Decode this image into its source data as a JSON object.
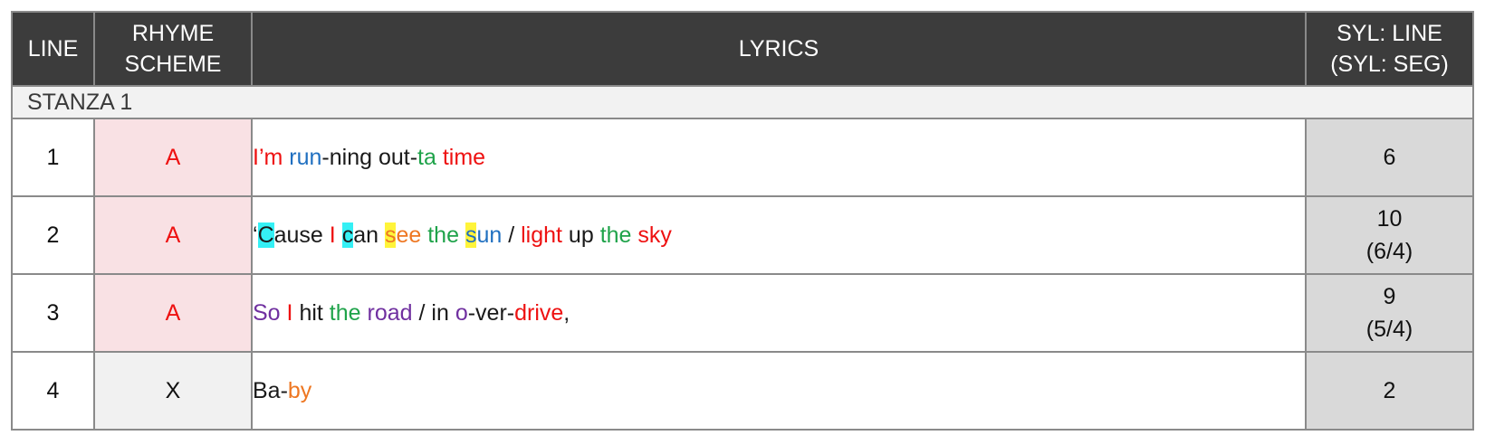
{
  "colors": {
    "header_bg": "#3c3c3c",
    "header_text": "#ffffff",
    "stanza_bg": "#f2f2f2",
    "rhyme_a_bg": "#f9e1e4",
    "rhyme_x_bg": "#f1f1f1",
    "syl_bg": "#d9d9d9",
    "red": "#ee1111",
    "blue": "#1f6fc0",
    "green": "#1fa34a",
    "orange": "#ee7722",
    "purple": "#7030a0",
    "black": "#1a1a1a",
    "highlight_cyan": "#35f0f5",
    "highlight_yellow": "#fff43a"
  },
  "headers": {
    "line": "LINE",
    "rhyme": "RHYME\nSCHEME",
    "lyrics": "LYRICS",
    "syl": "SYL: LINE\n(SYL: SEG)"
  },
  "stanza": {
    "label": "STANZA 1"
  },
  "rows": [
    {
      "line": "1",
      "rhyme": "A",
      "rhyme_style": "a",
      "syl": "6",
      "segments": [
        {
          "t": "I’m",
          "c": "red"
        },
        {
          "t": " ",
          "c": "black"
        },
        {
          "t": "run",
          "c": "blue"
        },
        {
          "t": "-ning out-",
          "c": "black"
        },
        {
          "t": "ta",
          "c": "green"
        },
        {
          "t": " ",
          "c": "black"
        },
        {
          "t": "time",
          "c": "red"
        }
      ]
    },
    {
      "line": "2",
      "rhyme": "A",
      "rhyme_style": "a",
      "syl": "10\n(6/4)",
      "segments": [
        {
          "t": "‘",
          "c": "black"
        },
        {
          "t": "C",
          "c": "black",
          "h": "cyan"
        },
        {
          "t": "ause ",
          "c": "black"
        },
        {
          "t": "I",
          "c": "red"
        },
        {
          "t": " ",
          "c": "black"
        },
        {
          "t": "c",
          "c": "black",
          "h": "cyan"
        },
        {
          "t": "an ",
          "c": "black"
        },
        {
          "t": "s",
          "c": "orange",
          "h": "yellow"
        },
        {
          "t": "ee",
          "c": "orange"
        },
        {
          "t": " ",
          "c": "black"
        },
        {
          "t": "the",
          "c": "green"
        },
        {
          "t": " ",
          "c": "black"
        },
        {
          "t": "s",
          "c": "blue",
          "h": "yellow"
        },
        {
          "t": "un",
          "c": "blue"
        },
        {
          "t": " / ",
          "c": "black"
        },
        {
          "t": "light",
          "c": "red"
        },
        {
          "t": " up ",
          "c": "black"
        },
        {
          "t": "the",
          "c": "green"
        },
        {
          "t": " ",
          "c": "black"
        },
        {
          "t": "sky",
          "c": "red"
        }
      ]
    },
    {
      "line": "3",
      "rhyme": "A",
      "rhyme_style": "a",
      "syl": "9\n(5/4)",
      "segments": [
        {
          "t": "So",
          "c": "purple"
        },
        {
          "t": " ",
          "c": "black"
        },
        {
          "t": "I",
          "c": "red"
        },
        {
          "t": " hit ",
          "c": "black"
        },
        {
          "t": "the",
          "c": "green"
        },
        {
          "t": " ",
          "c": "black"
        },
        {
          "t": "road",
          "c": "purple"
        },
        {
          "t": " / in ",
          "c": "black"
        },
        {
          "t": "o",
          "c": "purple"
        },
        {
          "t": "-ver-",
          "c": "black"
        },
        {
          "t": "drive",
          "c": "red"
        },
        {
          "t": ",",
          "c": "black"
        }
      ]
    },
    {
      "line": "4",
      "rhyme": "X",
      "rhyme_style": "x",
      "syl": "2",
      "segments": [
        {
          "t": "Ba-",
          "c": "black"
        },
        {
          "t": "by",
          "c": "orange"
        }
      ]
    }
  ]
}
